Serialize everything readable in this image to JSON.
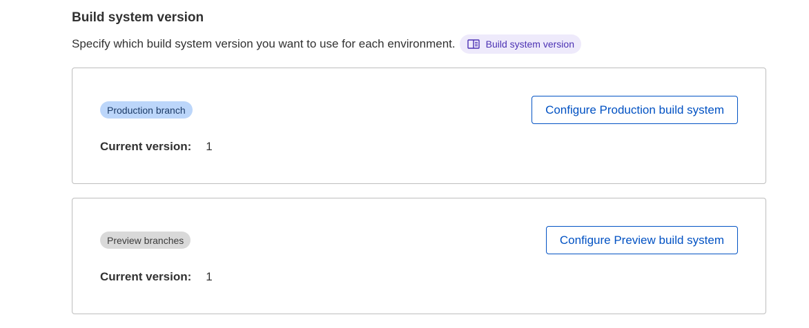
{
  "section": {
    "title": "Build system version",
    "description": "Specify which build system version you want to use for each environment.",
    "doc_link": {
      "label": "Build system version",
      "icon": "book-icon"
    }
  },
  "cards": [
    {
      "badge": "Production branch",
      "version_label": "Current version:",
      "version_value": "1",
      "button_label": "Configure Production build system"
    },
    {
      "badge": "Preview branches",
      "version_label": "Current version:",
      "version_value": "1",
      "button_label": "Configure Preview build system"
    }
  ],
  "colors": {
    "accent": "#0051c3",
    "production_badge_bg": "#bcd6fa",
    "preview_badge_bg": "#d9d9d9",
    "doc_link_bg": "#eeeafb",
    "doc_link_text": "#4b31b3"
  }
}
